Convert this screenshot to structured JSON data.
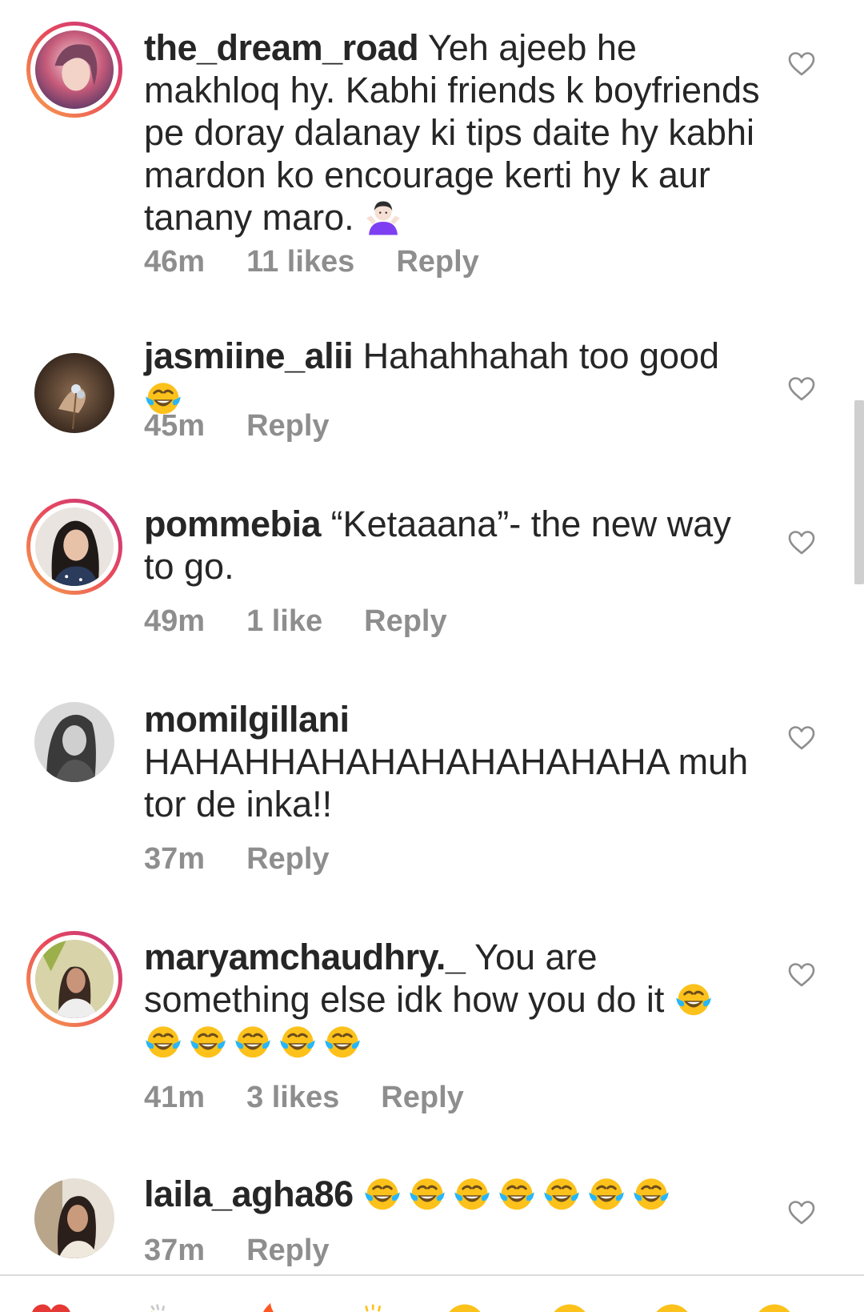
{
  "comments": [
    {
      "username": "the_dream_road",
      "text": "Yeh ajeeb he makhloq hy.  Kabhi friends k boyfriends pe doray dalanay ki tips daite hy kabhi mardon ko encourage kerti hy k aur tanany maro.",
      "emoji": "person-shrugging-emoji",
      "time": "46m",
      "likes": "11 likes",
      "reply": "Reply",
      "has_story_ring": true
    },
    {
      "username": "jasmiine_alii",
      "text": "Hahahhahah too good",
      "emoji": "tears-of-joy-emoji",
      "time": "45m",
      "reply": "Reply",
      "has_story_ring": false
    },
    {
      "username": "pommebia",
      "text": "“Ketaaana”- the new way to go.",
      "time": "49m",
      "likes": "1 like",
      "reply": "Reply",
      "has_story_ring": true
    },
    {
      "username": "momilgillani",
      "text": "HAHAHHAHAHAHAHAHAHAHA muh tor de inka!!",
      "time": "37m",
      "reply": "Reply",
      "has_story_ring": false
    },
    {
      "username": "maryamchaudhry._",
      "text": "You are something else idk how you do it",
      "emoji": "tears-of-joy-emoji",
      "emoji_count": 6,
      "time": "41m",
      "likes": "3 likes",
      "reply": "Reply",
      "has_story_ring": true
    },
    {
      "username": "laila_agha86",
      "emoji": "tears-of-joy-emoji",
      "emoji_count": 7,
      "time": "37m",
      "reply": "Reply",
      "has_story_ring": false
    }
  ],
  "icons": {
    "like": "heart-outline-icon"
  },
  "quick_reactions": [
    "red-heart-emoji",
    "clapping-hands-emoji",
    "fire-emoji",
    "raising-hands-emoji",
    "crying-face-emoji",
    "heart-eyes-emoji",
    "open-mouth-emoji",
    "tears-of-joy-emoji"
  ],
  "colors": {
    "text": "#262626",
    "meta": "#8e8e8e",
    "ring_start": "#f9a44a",
    "ring_end": "#c13584",
    "divider": "#dbdbdb"
  }
}
